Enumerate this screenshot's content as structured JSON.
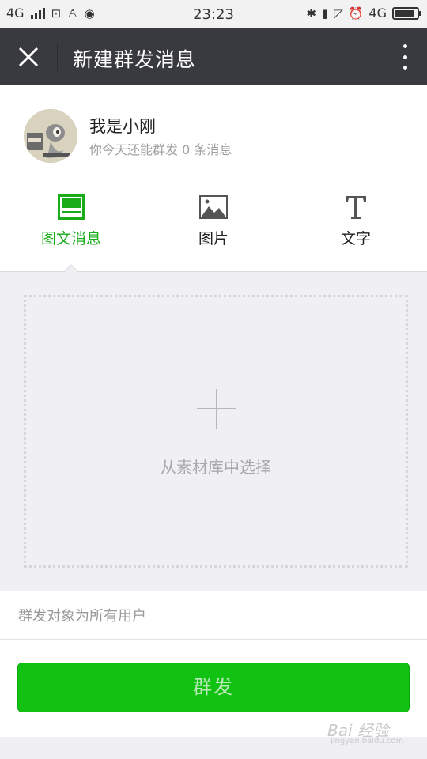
{
  "status_bar": {
    "network_left": "4G",
    "time": "23:23",
    "network_right": "4G",
    "battery_level": 0.9
  },
  "header": {
    "title": "新建群发消息"
  },
  "account": {
    "name": "我是小刚",
    "quota_text": "你今天还能群发 0 条消息"
  },
  "tabs": [
    {
      "label": "图文消息",
      "icon": "news-icon",
      "active": true
    },
    {
      "label": "图片",
      "icon": "image-icon",
      "active": false
    },
    {
      "label": "文字",
      "icon": "text-icon",
      "active": false
    }
  ],
  "dropzone": {
    "label": "从素材库中选择"
  },
  "audience": {
    "text": "群发对象为所有用户"
  },
  "send_button": {
    "label": "群发"
  },
  "watermark": {
    "main": "Bai 经验",
    "sub": "jingyan.baidu.com"
  },
  "colors": {
    "accent_green": "#1aad19",
    "button_green": "#12c212",
    "titlebar_bg": "#393a3f"
  }
}
